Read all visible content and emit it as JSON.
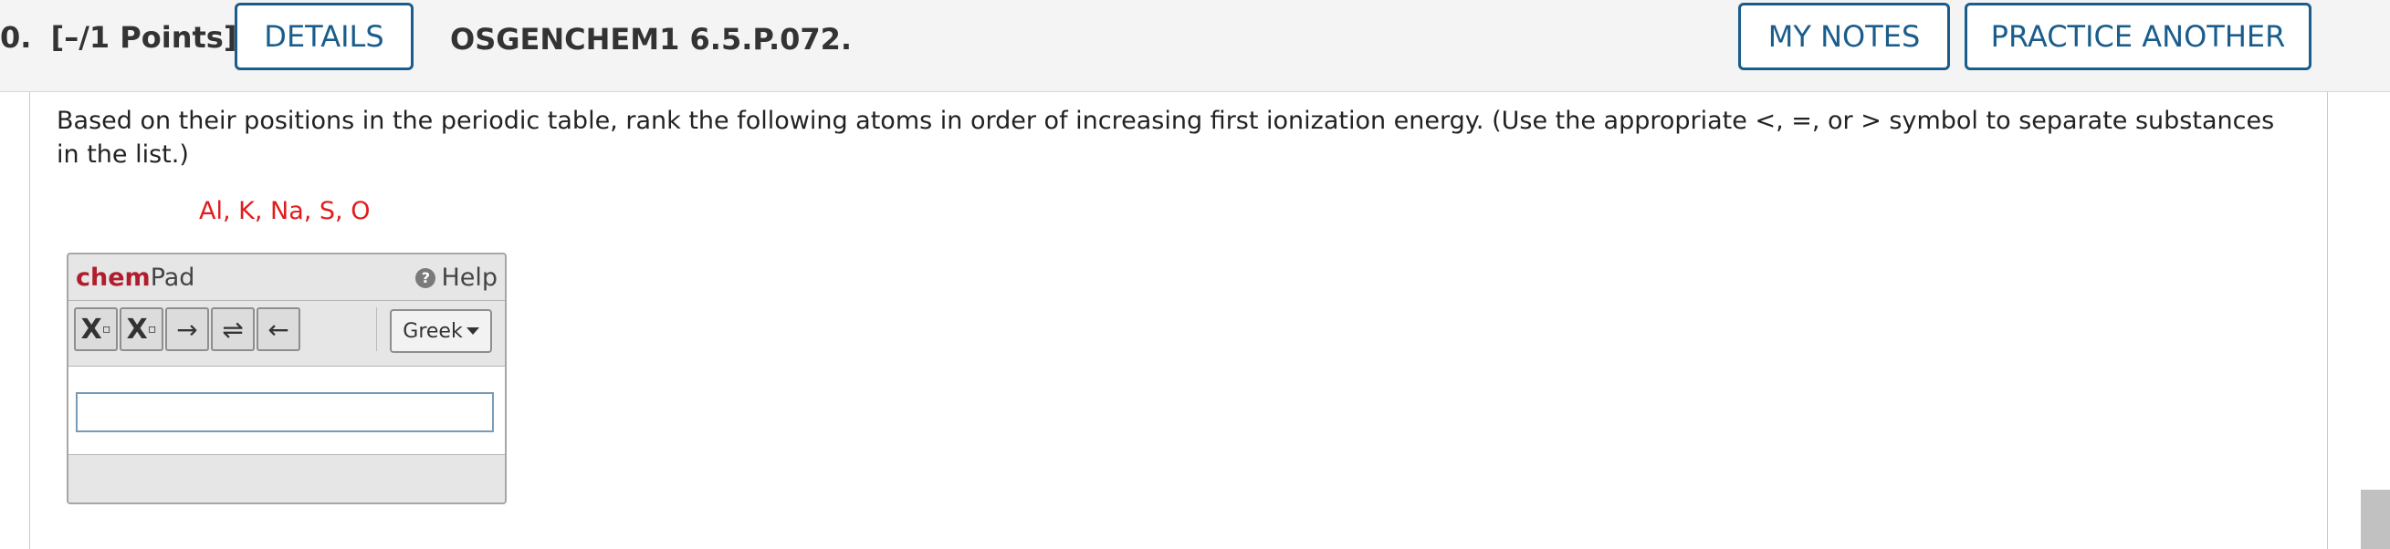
{
  "header": {
    "question_number": "0.",
    "points": "[–/1 Points]",
    "details_label": "DETAILS",
    "question_id": "OSGENCHEM1 6.5.P.072.",
    "my_notes_label": "MY NOTES",
    "practice_another_label": "PRACTICE ANOTHER"
  },
  "question": {
    "text": "Based on their positions in the periodic table, rank the following atoms in order of increasing first ionization energy. (Use the appropriate <, =, or > symbol to separate substances in the list.)",
    "atoms": "Al, K, Na, S, O"
  },
  "chempad": {
    "brand": "chem",
    "brand_suffix": "Pad",
    "help_label": "Help",
    "help_icon": "?",
    "tools": {
      "subscript": "X",
      "superscript": "X",
      "arrow_right": "→",
      "arrow_equilibrium": "⇌",
      "arrow_left": "←"
    },
    "greek_label": "Greek",
    "input_value": ""
  },
  "colors": {
    "accent": "#1a5d8c",
    "atoms_text": "#e21c1c",
    "brand": "#b01e2e"
  }
}
